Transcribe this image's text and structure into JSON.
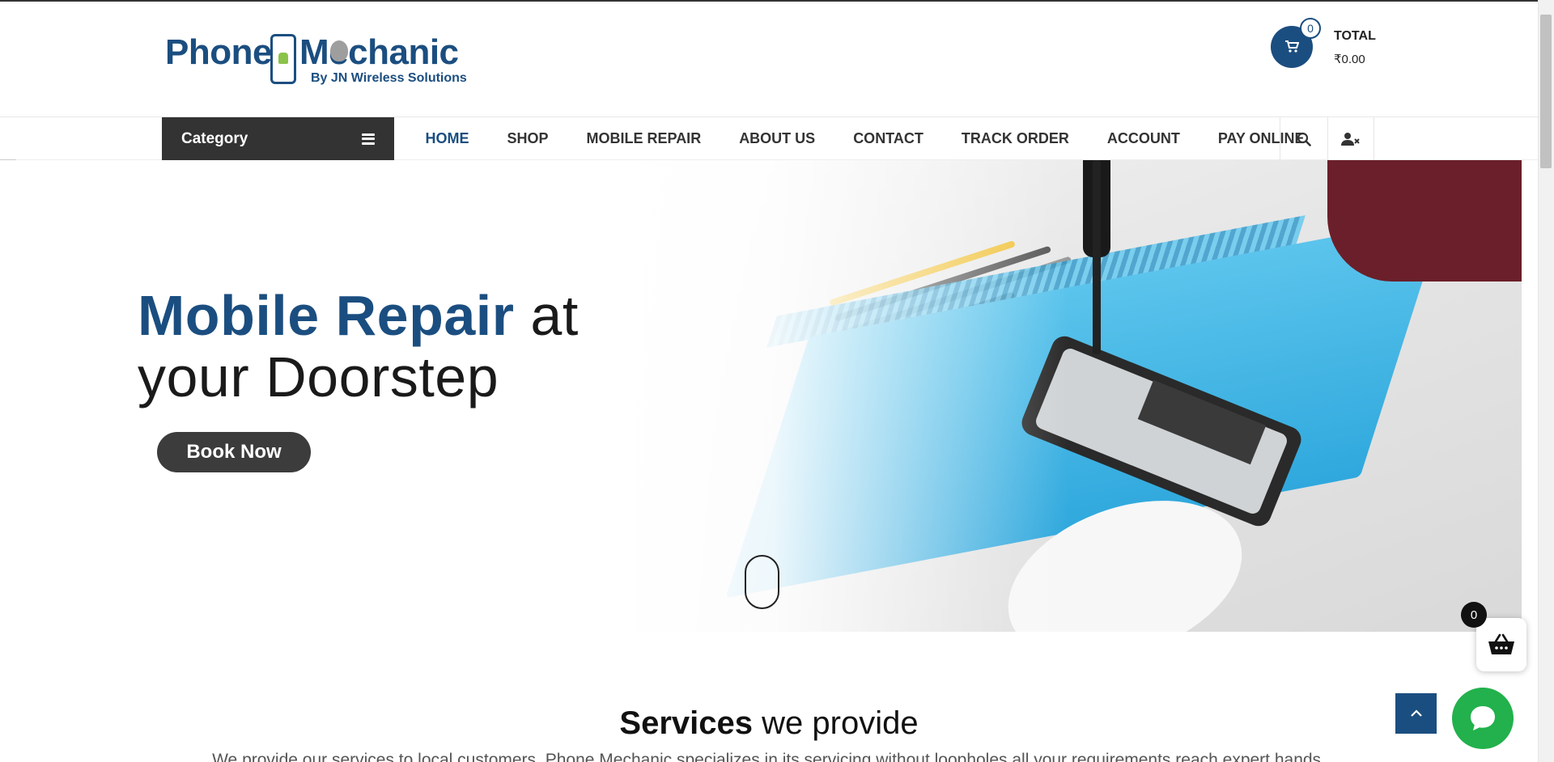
{
  "brand": {
    "logo_word_1": "Phone",
    "logo_word_2": "Mechanic",
    "logo_tagline_by": "By",
    "logo_tagline_company": "JN Wireless Solutions"
  },
  "cart": {
    "count": "0",
    "total_label": "TOTAL",
    "total_value": "₹0.00"
  },
  "navbar": {
    "category_label": "Category",
    "links": [
      "HOME",
      "SHOP",
      "MOBILE REPAIR",
      "ABOUT US",
      "CONTACT",
      "TRACK ORDER",
      "ACCOUNT",
      "PAY ONLINE"
    ],
    "active": "HOME"
  },
  "hero": {
    "title_highlight": "Mobile Repair",
    "title_rest_1": " at",
    "title_rest_2": "your Doorstep",
    "cta_label": "Book Now"
  },
  "services": {
    "title_strong": "Services",
    "title_rest": " we provide",
    "intro": "We provide our services to local customers. Phone Mechanic specializes in its servicing without loopholes all your requirements reach expert hands."
  },
  "floating": {
    "cart_count": "0"
  },
  "colors": {
    "brand_blue": "#1b4e80",
    "dark": "#333333",
    "chat_green": "#22b14c"
  },
  "icons": {
    "cart": "shopping-cart-icon",
    "search": "search-icon",
    "user": "user-times-icon",
    "basket": "basket-icon",
    "chevron_up": "chevron-up-icon",
    "chat": "chat-bubble-icon",
    "menu": "hamburger-menu-icon",
    "scroll": "mouse-scroll-icon"
  }
}
